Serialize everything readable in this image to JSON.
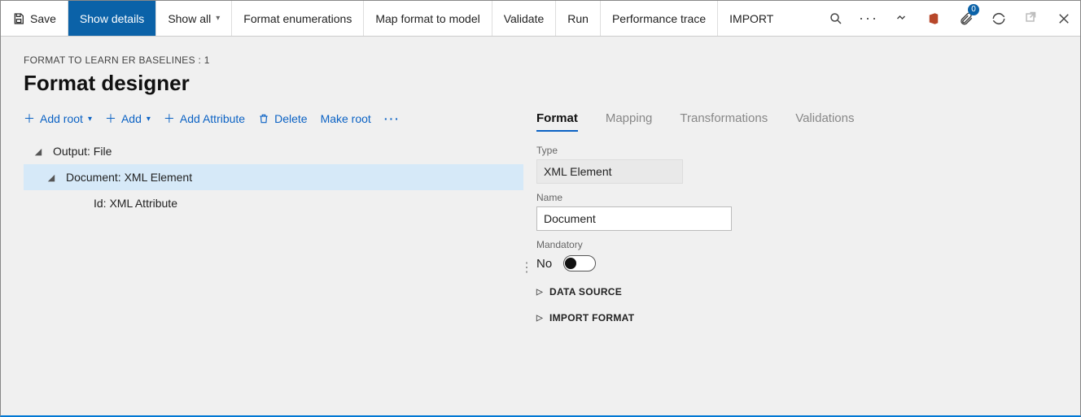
{
  "toolbar": {
    "save": "Save",
    "show_details": "Show details",
    "show_all": "Show all",
    "format_enum": "Format enumerations",
    "map_format": "Map format to model",
    "validate": "Validate",
    "run": "Run",
    "perf_trace": "Performance trace",
    "import": "IMPORT",
    "badge_count": "0"
  },
  "breadcrumb": "FORMAT TO LEARN ER BASELINES : 1",
  "page_title": "Format designer",
  "cmd": {
    "add_root": "Add root",
    "add": "Add",
    "add_attr": "Add Attribute",
    "delete": "Delete",
    "make_root": "Make root"
  },
  "tree": {
    "n0": "Output: File",
    "n1": "Document: XML Element",
    "n2": "Id: XML Attribute"
  },
  "tabs": {
    "format": "Format",
    "mapping": "Mapping",
    "transformations": "Transformations",
    "validations": "Validations"
  },
  "panel": {
    "type_label": "Type",
    "type_value": "XML Element",
    "name_label": "Name",
    "name_value": "Document",
    "mandatory_label": "Mandatory",
    "mandatory_value": "No",
    "exp_datasource": "DATA SOURCE",
    "exp_import": "IMPORT FORMAT"
  }
}
